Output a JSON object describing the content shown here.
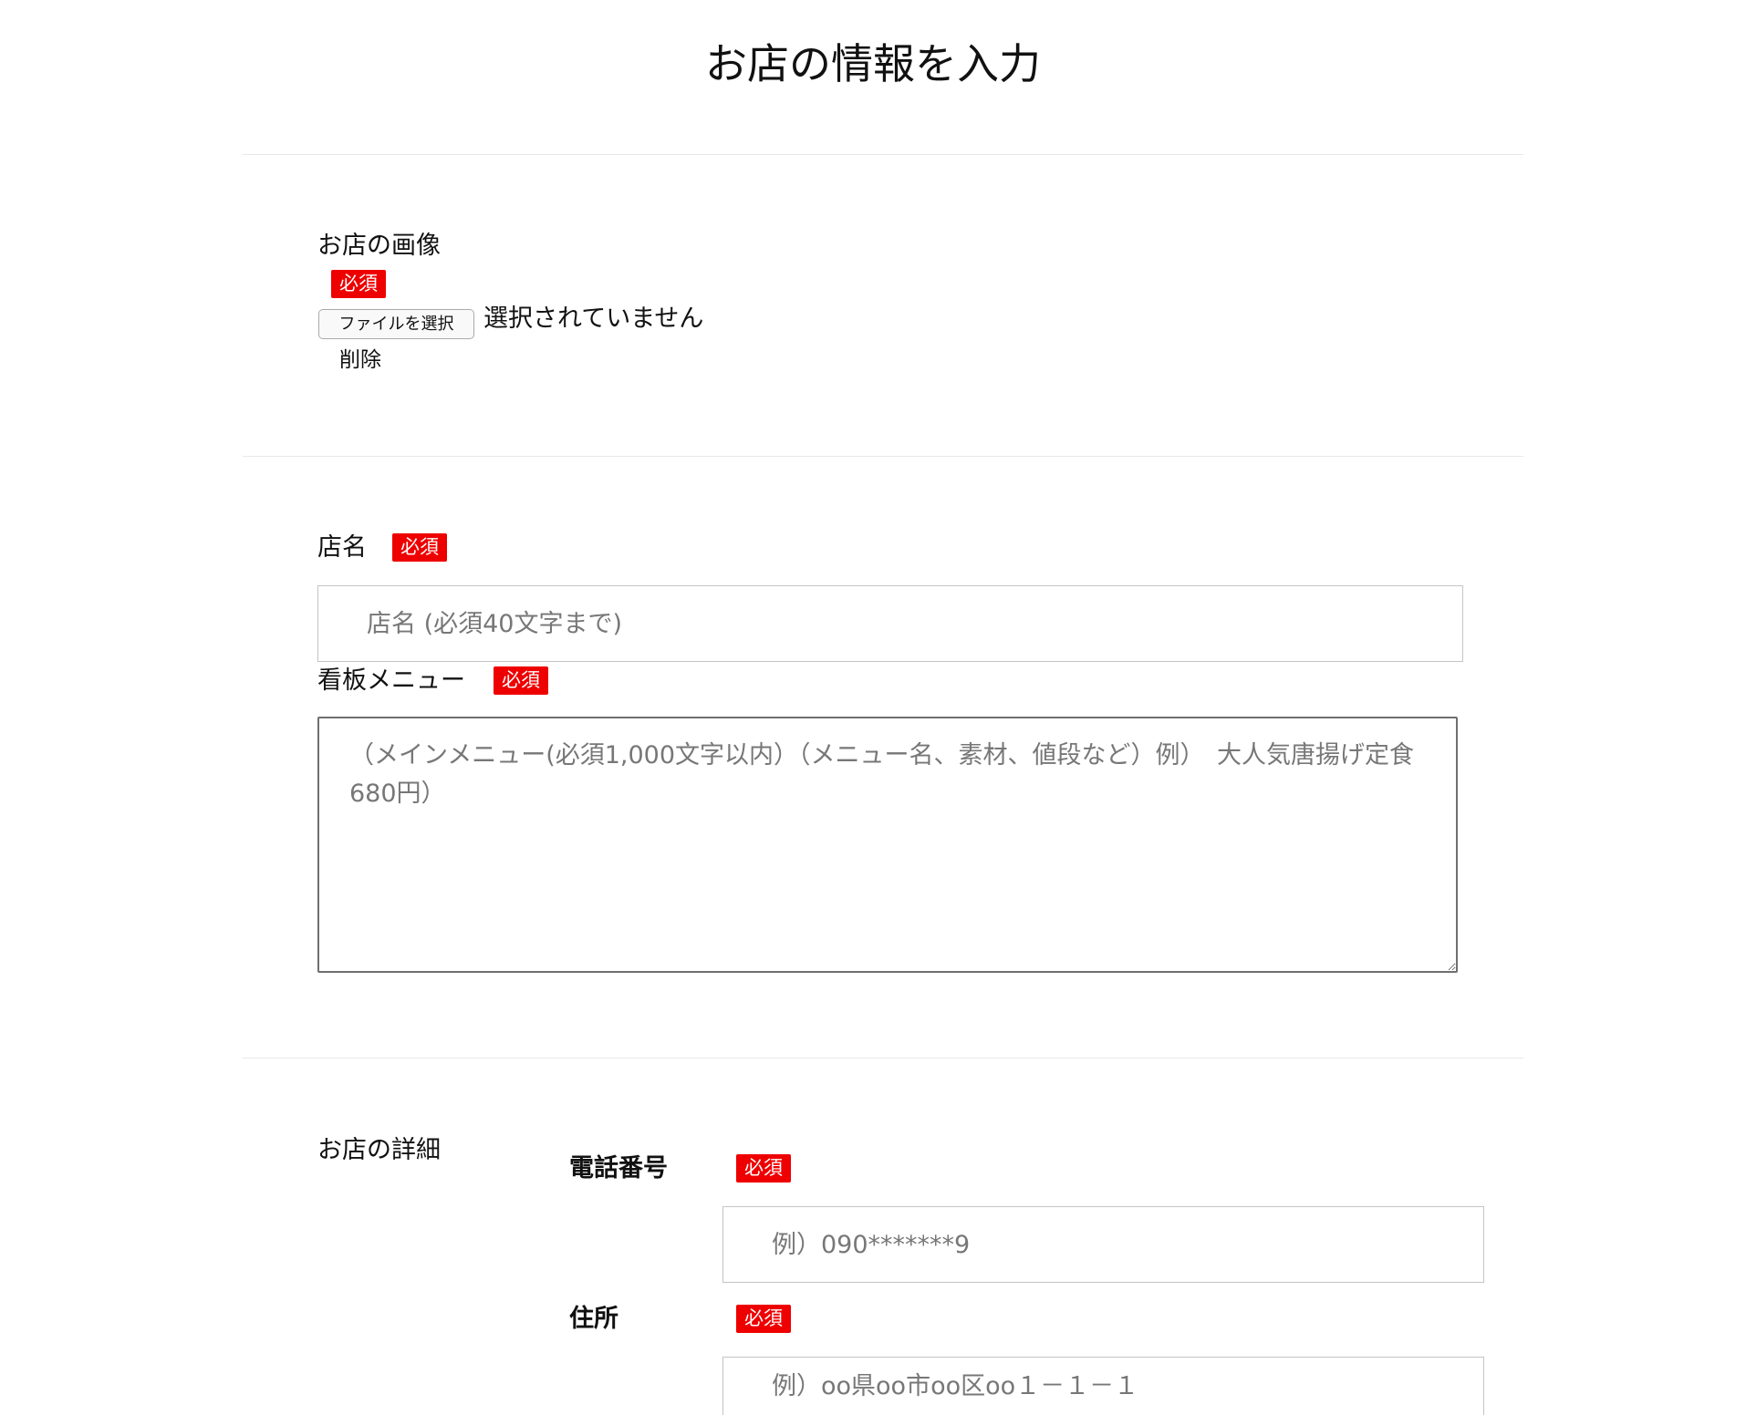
{
  "page": {
    "title": "お店の情報を入力"
  },
  "required_badge": "必須",
  "image_section": {
    "label": "お店の画像",
    "file_button_label": "ファイルを選択",
    "file_status": "選択されていません",
    "delete_label": "削除"
  },
  "shop_name": {
    "label": "店名",
    "value": "",
    "placeholder": "店名 (必須40文字まで)"
  },
  "signature_menu": {
    "label": "看板メニュー",
    "value": "",
    "placeholder": "（メインメニュー(必須1,000文字以内）（メニュー名、素材、値段など）例）　大人気唐揚げ定食　680円）"
  },
  "details": {
    "label": "お店の詳細",
    "phone": {
      "label": "電話番号",
      "value": "",
      "placeholder": "例）090*******9"
    },
    "address": {
      "label": "住所",
      "value": "",
      "placeholder": "例）oo県oo市oo区oo１－１－１"
    }
  },
  "colors": {
    "badge_background": "#ee0000",
    "badge_text": "#ffffff",
    "divider": "#e8e8e8",
    "placeholder_text": "#777777"
  }
}
